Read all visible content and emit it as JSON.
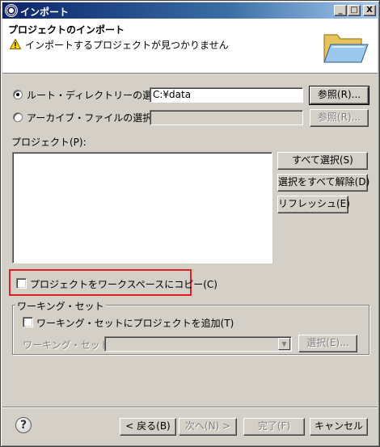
{
  "window": {
    "title": "インポート",
    "controls": {
      "minimize": "_",
      "maximize": "□",
      "close": "X"
    }
  },
  "header": {
    "title": "プロジェクトのインポート",
    "message": "インポートするプロジェクトが見つかりません",
    "message_icon": "warning-icon",
    "banner_icon": "open-folder-icon"
  },
  "source": {
    "root_dir_label": "ルート・ディレクトリーの選択(T):",
    "root_dir_selected": true,
    "root_dir_value": "C:¥data",
    "root_browse_label": "参照(R)...",
    "archive_label": "アーカイブ・ファイルの選択(A):",
    "archive_selected": false,
    "archive_value": "",
    "archive_browse_label": "参照(R)..."
  },
  "projects": {
    "label": "プロジェクト(P):",
    "items": [],
    "select_all_label": "すべて選択(S)",
    "deselect_all_label": "選択をすべて解除(D)",
    "refresh_label": "リフレッシュ(E)"
  },
  "copy_option": {
    "label": "プロジェクトをワークスペースにコピー(C)",
    "checked": false,
    "highlight_color": "#e02020"
  },
  "working_set": {
    "group_title": "ワーキング・セット",
    "add_label": "ワーキング・セットにプロジェクトを追加(T)",
    "add_checked": false,
    "sets_label": "ワーキング・セット(O):",
    "sets_value": "",
    "select_label": "選択(E)..."
  },
  "footer": {
    "help_icon": "help-icon",
    "back_label": "< 戻る(B)",
    "next_label": "次へ(N) >",
    "finish_label": "完了(F)",
    "cancel_label": "キャンセル"
  }
}
